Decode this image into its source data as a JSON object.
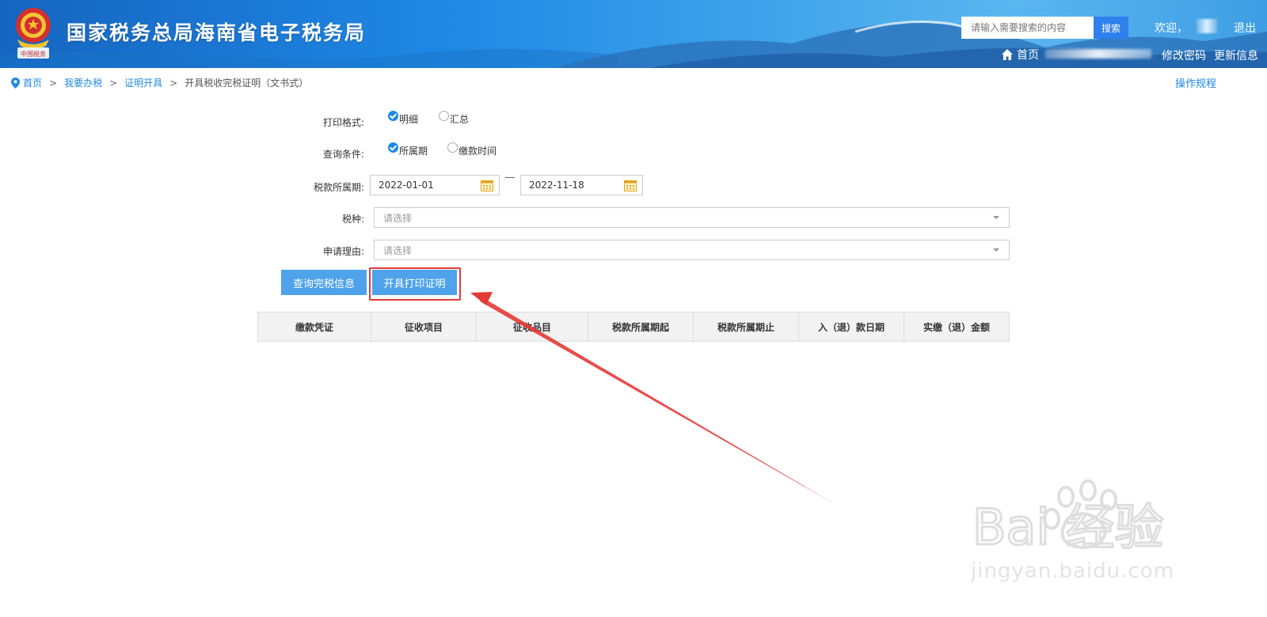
{
  "header": {
    "title": "国家税务总局海南省电子税务局",
    "emblem_caption": "中国税务",
    "search_placeholder": "请输入需要搜索的内容",
    "search_button": "搜索",
    "welcome": "欢迎，",
    "logout": "退出",
    "home": "首页",
    "change_password": "修改密码",
    "update_info": "更新信息"
  },
  "breadcrumb": {
    "items": [
      "首页",
      "我要办税",
      "证明开具"
    ],
    "current": "开具税收完税证明（文书式）",
    "separator": ">"
  },
  "ops_link": "操作规程",
  "form": {
    "print_format": {
      "label": "打印格式:",
      "options": [
        {
          "label": "明细",
          "checked": true
        },
        {
          "label": "汇总",
          "checked": false
        }
      ]
    },
    "query_condition": {
      "label": "查询条件:",
      "options": [
        {
          "label": "所属期",
          "checked": true
        },
        {
          "label": "缴款时间",
          "checked": false
        }
      ]
    },
    "tax_period": {
      "label": "税款所属期:",
      "start": "2022-01-01",
      "end": "2022-11-18"
    },
    "tax_type": {
      "label": "税种:",
      "placeholder": "请选择"
    },
    "reason": {
      "label": "申请理由:",
      "placeholder": "请选择"
    }
  },
  "buttons": {
    "query": "查询完税信息",
    "print": "开具打印证明"
  },
  "table": {
    "columns": [
      "缴款凭证",
      "征收项目",
      "征收品目",
      "税款所属期起",
      "税款所属期止",
      "入（退）款日期",
      "实缴（退）金额"
    ]
  },
  "watermark": {
    "logo_text": "Bai 经验",
    "url": "jingyan.baidu.com"
  },
  "colors": {
    "header_blue": "#1e88e5",
    "link_blue": "#1e88e5",
    "button_blue": "#4ea3ea",
    "annotation_red": "#e53935"
  }
}
